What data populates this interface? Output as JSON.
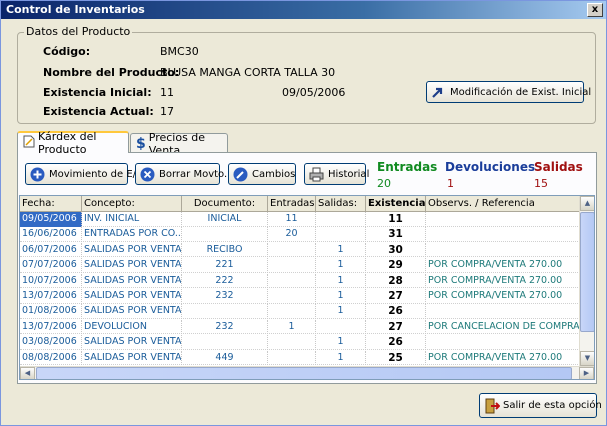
{
  "window": {
    "title": "Control de Inventarios",
    "close_glyph": "x"
  },
  "producto": {
    "legend": "Datos del Producto",
    "codigo_label": "Código:",
    "codigo_value": "BMC30",
    "nombre_label": "Nombre del Producto:",
    "nombre_value": "BLUSA MANGA CORTA TALLA 30",
    "exist_inicial_label": "Existencia Inicial:",
    "exist_inicial_value": "11",
    "exist_inicial_fecha": "09/05/2006",
    "exist_actual_label": "Existencia Actual:",
    "exist_actual_value": "17",
    "modificacion_button": "Modificación de Exist. Inicial"
  },
  "tabs": [
    {
      "label": "Kárdex del Producto",
      "icon": "document-icon",
      "active": true
    },
    {
      "label": "Precios de Venta",
      "icon": "dollar-icon",
      "active": false
    }
  ],
  "toolbar": {
    "movimiento": "Movimiento de E/S",
    "borrar": "Borrar Movto.",
    "cambios": "Cambios",
    "historial": "Historial"
  },
  "totales": {
    "entradas_label": "Entradas",
    "entradas_value": "20",
    "devoluciones_label": "Devoluciones",
    "devoluciones_value": "1",
    "salidas_label": "Salidas",
    "salidas_value": "15",
    "colors": {
      "entradas": "#108a20",
      "devoluciones": "#1a3d9a",
      "salidas": "#a01010"
    }
  },
  "grid": {
    "columns": [
      "Fecha:",
      "Concepto:",
      "Documento:",
      "Entradas:",
      "Salidas:",
      "Existencia:",
      "Observs. / Referencia"
    ],
    "rows": [
      {
        "fecha": "09/05/2006",
        "concepto": "INV. INICIAL",
        "documento": "INICIAL",
        "entradas": "11",
        "salidas": "",
        "existencia": "11",
        "referencia": ""
      },
      {
        "fecha": "16/06/2006",
        "concepto": "ENTRADAS POR CO...",
        "documento": "",
        "entradas": "20",
        "salidas": "",
        "existencia": "31",
        "referencia": ""
      },
      {
        "fecha": "06/07/2006",
        "concepto": "SALIDAS POR VENTA",
        "documento": "RECIBO",
        "entradas": "",
        "salidas": "1",
        "existencia": "30",
        "referencia": ""
      },
      {
        "fecha": "07/07/2006",
        "concepto": "SALIDAS POR VENTA",
        "documento": "221",
        "entradas": "",
        "salidas": "1",
        "existencia": "29",
        "referencia": "POR COMPRA/VENTA 270.00"
      },
      {
        "fecha": "10/07/2006",
        "concepto": "SALIDAS POR VENTA",
        "documento": "222",
        "entradas": "",
        "salidas": "1",
        "existencia": "28",
        "referencia": "POR COMPRA/VENTA 270.00"
      },
      {
        "fecha": "13/07/2006",
        "concepto": "SALIDAS POR VENTA",
        "documento": "232",
        "entradas": "",
        "salidas": "1",
        "existencia": "27",
        "referencia": "POR COMPRA/VENTA 270.00"
      },
      {
        "fecha": "01/08/2006",
        "concepto": "SALIDAS POR VENTA",
        "documento": "",
        "entradas": "",
        "salidas": "1",
        "existencia": "26",
        "referencia": ""
      },
      {
        "fecha": "13/07/2006",
        "concepto": "DEVOLUCION",
        "documento": "232",
        "entradas": "1",
        "salidas": "",
        "existencia": "27",
        "referencia": "POR CANCELACION DE COMPRA"
      },
      {
        "fecha": "03/08/2006",
        "concepto": "SALIDAS POR VENTA",
        "documento": "",
        "entradas": "",
        "salidas": "1",
        "existencia": "26",
        "referencia": ""
      },
      {
        "fecha": "08/08/2006",
        "concepto": "SALIDAS POR VENTA",
        "documento": "449",
        "entradas": "",
        "salidas": "1",
        "existencia": "25",
        "referencia": "POR COMPRA/VENTA 270.00"
      }
    ],
    "selected_row": 0
  },
  "exit_button": "Salir de esta opción"
}
